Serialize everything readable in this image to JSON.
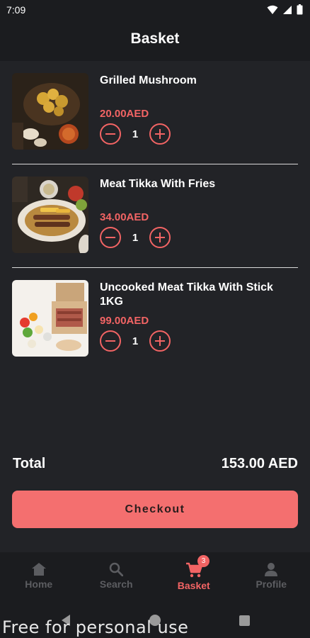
{
  "status_bar": {
    "time": "7:09"
  },
  "header": {
    "title": "Basket"
  },
  "items": [
    {
      "name": "Grilled Mushroom",
      "price": "20.00AED",
      "quantity": "1"
    },
    {
      "name": "Meat Tikka With Fries",
      "price": "34.00AED",
      "quantity": "1"
    },
    {
      "name": "Uncooked Meat Tikka With Stick 1KG",
      "price": "99.00AED",
      "quantity": "1"
    }
  ],
  "summary": {
    "total_label": "Total",
    "total_value": "153.00 AED"
  },
  "checkout": {
    "label": "Checkout"
  },
  "bottom_nav": {
    "items": [
      {
        "label": "Home",
        "icon": "home-icon"
      },
      {
        "label": "Search",
        "icon": "search-icon"
      },
      {
        "label": "Basket",
        "icon": "cart-icon",
        "badge": "3",
        "active": true
      },
      {
        "label": "Profile",
        "icon": "person-icon"
      }
    ]
  },
  "watermark": "Free for personal use",
  "colors": {
    "accent": "#f26464",
    "background": "#222327",
    "bar": "#1b1c1f",
    "inactive": "#5c5d61"
  }
}
